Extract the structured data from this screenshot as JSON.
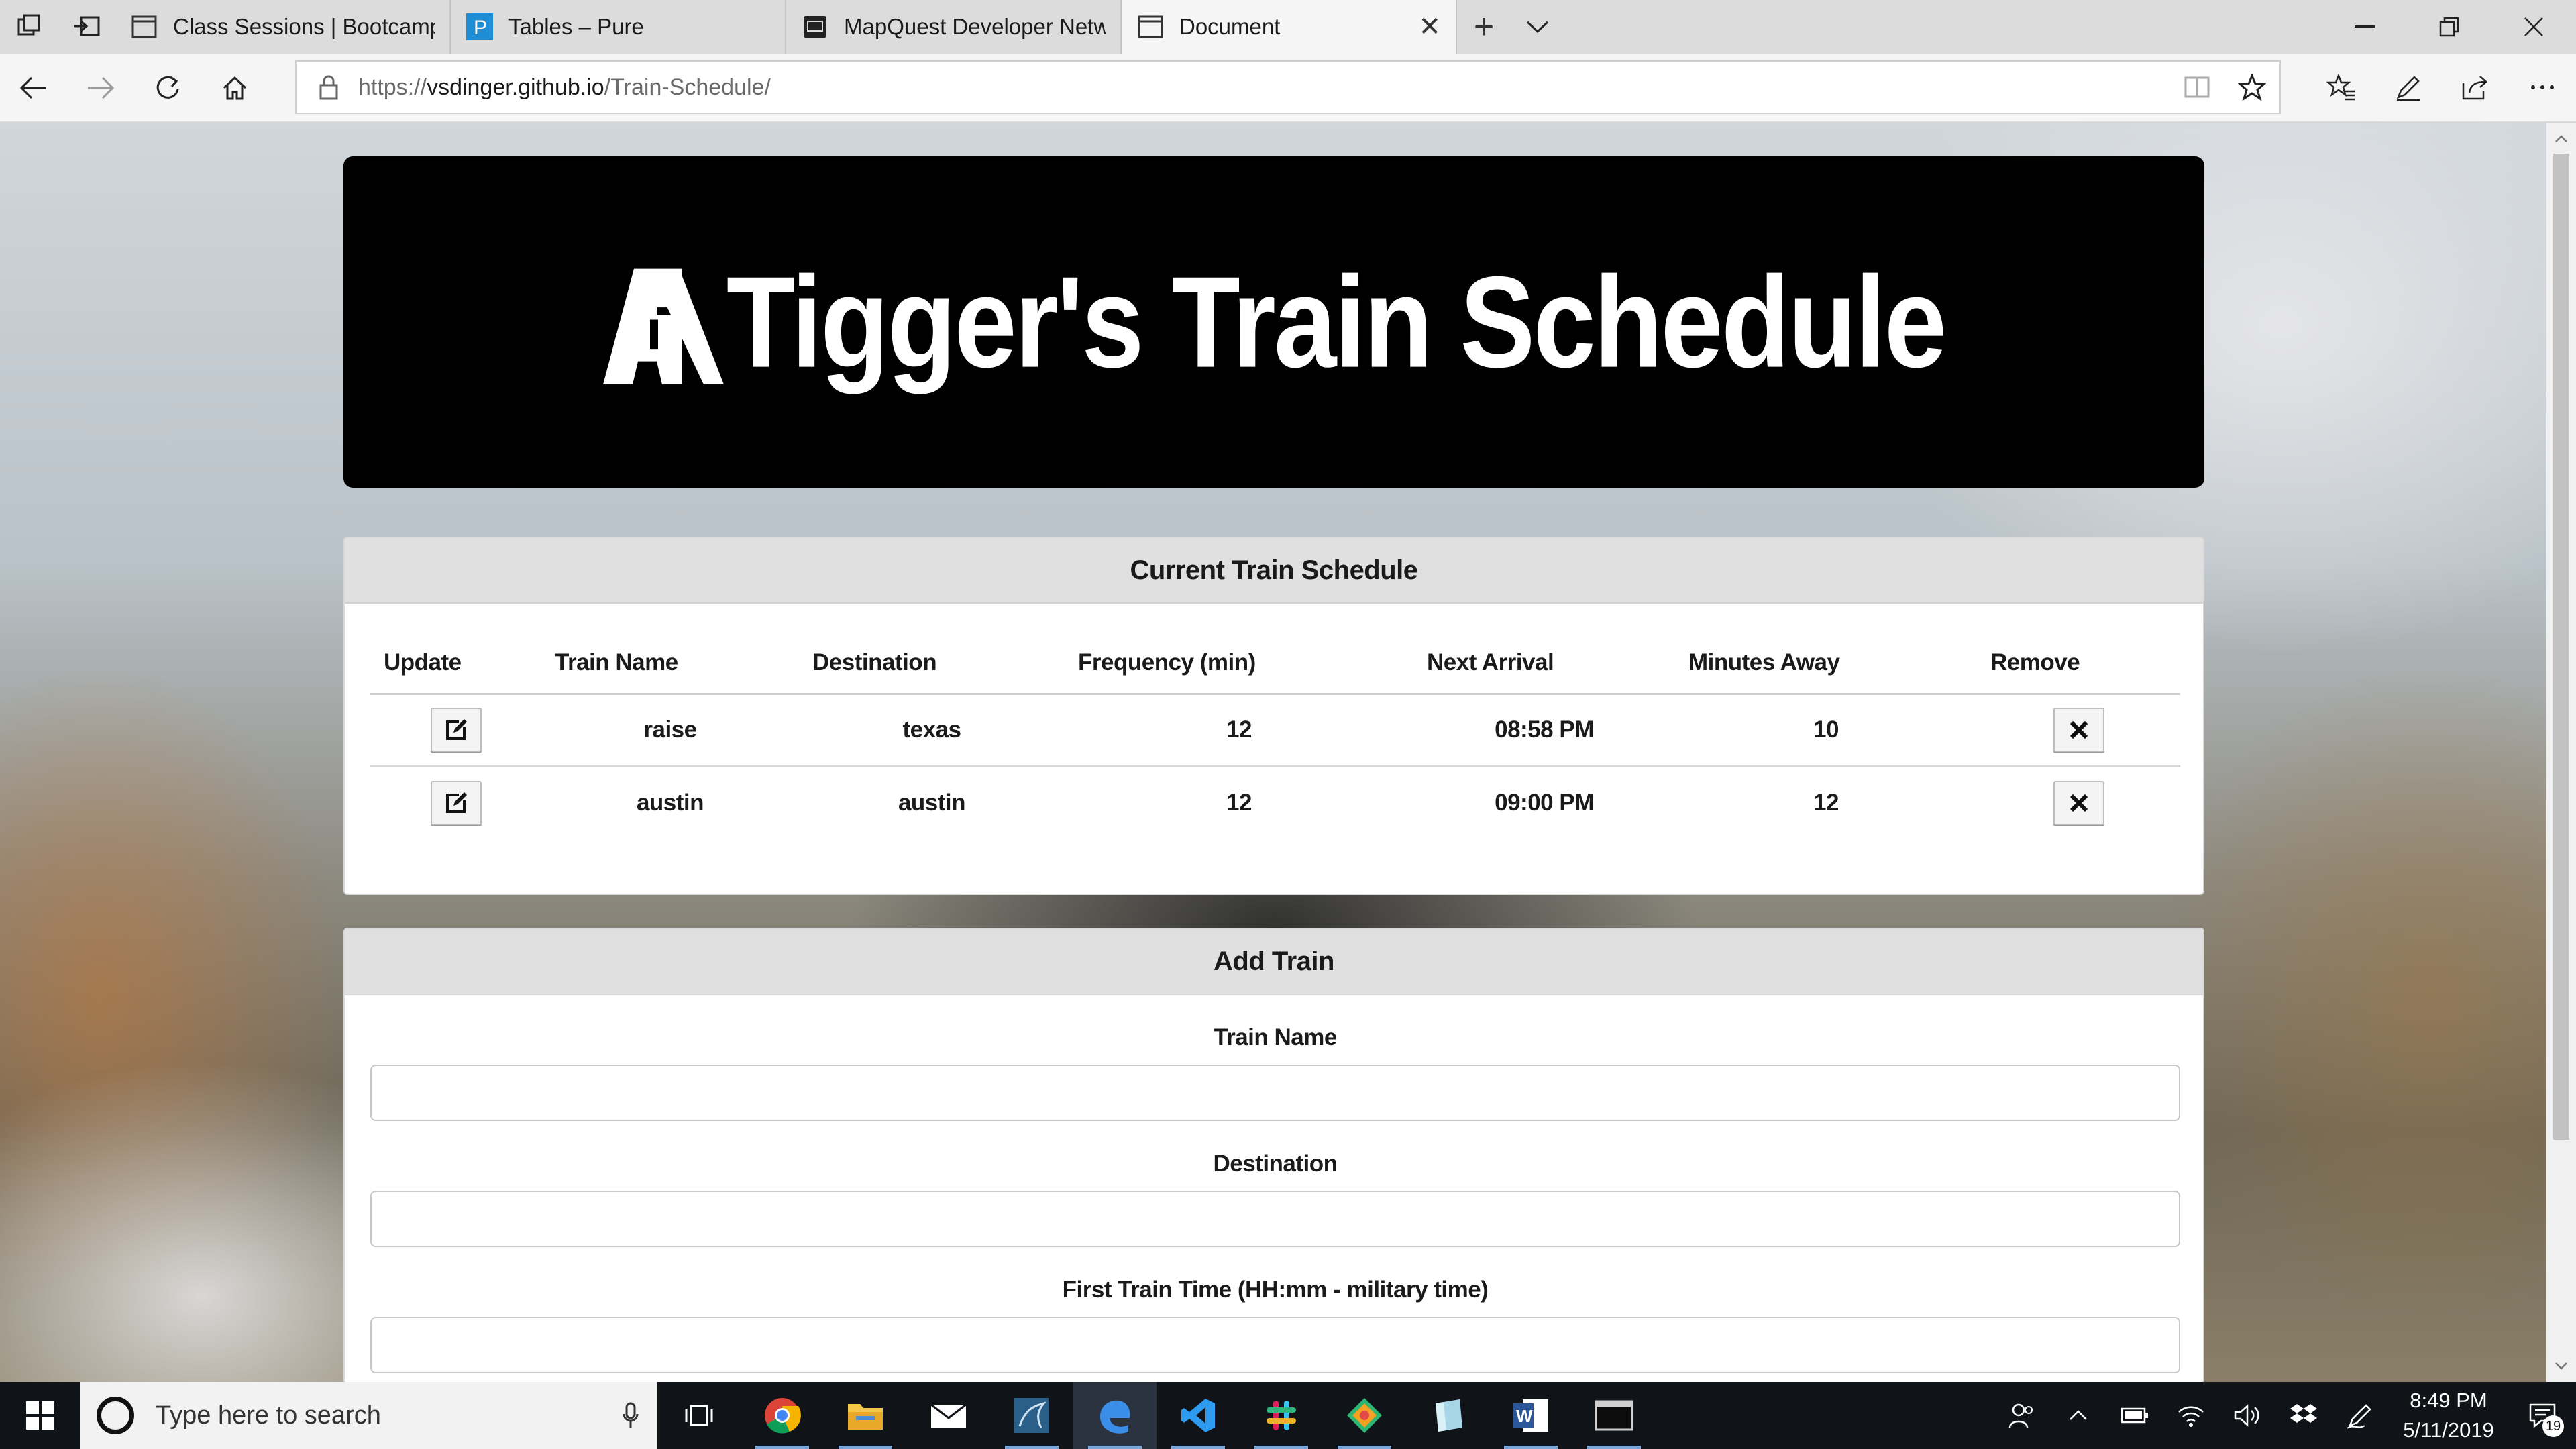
{
  "browser": {
    "tabs": [
      {
        "title": "Class Sessions | Bootcamp S",
        "icon": "page-icon"
      },
      {
        "title": "Tables – Pure",
        "icon": "pure-p-icon"
      },
      {
        "title": "MapQuest Developer Netw",
        "icon": "mapquest-icon"
      },
      {
        "title": "Document",
        "icon": "page-icon",
        "active": true
      }
    ],
    "url_prefix": "https://",
    "url_host": "vsdinger.github.io",
    "url_path": "/Train-Schedule/"
  },
  "page": {
    "title": "Tigger's Train Schedule",
    "schedule": {
      "header": "Current Train Schedule",
      "columns": [
        "Update",
        "Train Name",
        "Destination",
        "Frequency (min)",
        "Next Arrival",
        "Minutes Away",
        "Remove"
      ],
      "rows": [
        {
          "name": "raise",
          "destination": "texas",
          "frequency": "12",
          "next_arrival": "08:58 PM",
          "minutes_away": "10"
        },
        {
          "name": "austin",
          "destination": "austin",
          "frequency": "12",
          "next_arrival": "09:00 PM",
          "minutes_away": "12"
        }
      ]
    },
    "add_train": {
      "header": "Add Train",
      "labels": [
        "Train Name",
        "Destination",
        "First Train Time (HH:mm - military time)"
      ]
    }
  },
  "taskbar": {
    "search_placeholder": "Type here to search",
    "time": "8:49 PM",
    "date": "5/11/2019",
    "notification_count": "19"
  },
  "colors": {
    "accent": "#7aa7d8",
    "jumbotron": "#000000",
    "card_header": "#e0e0e0",
    "taskbar": "#101318"
  }
}
